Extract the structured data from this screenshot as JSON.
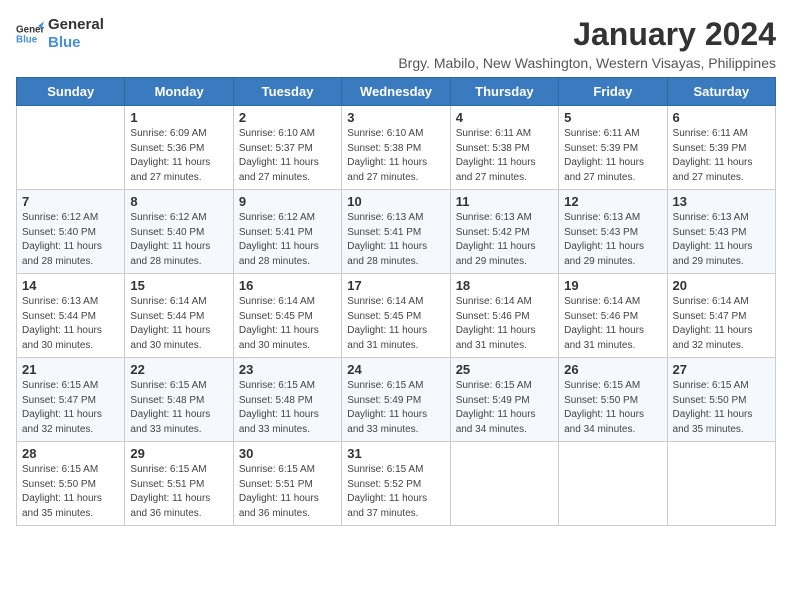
{
  "logo": {
    "line1": "General",
    "line2": "Blue"
  },
  "title": "January 2024",
  "subtitle": "Brgy. Mabilo, New Washington, Western Visayas, Philippines",
  "days_of_week": [
    "Sunday",
    "Monday",
    "Tuesday",
    "Wednesday",
    "Thursday",
    "Friday",
    "Saturday"
  ],
  "weeks": [
    [
      {
        "day": "",
        "info": ""
      },
      {
        "day": "1",
        "info": "Sunrise: 6:09 AM\nSunset: 5:36 PM\nDaylight: 11 hours\nand 27 minutes."
      },
      {
        "day": "2",
        "info": "Sunrise: 6:10 AM\nSunset: 5:37 PM\nDaylight: 11 hours\nand 27 minutes."
      },
      {
        "day": "3",
        "info": "Sunrise: 6:10 AM\nSunset: 5:38 PM\nDaylight: 11 hours\nand 27 minutes."
      },
      {
        "day": "4",
        "info": "Sunrise: 6:11 AM\nSunset: 5:38 PM\nDaylight: 11 hours\nand 27 minutes."
      },
      {
        "day": "5",
        "info": "Sunrise: 6:11 AM\nSunset: 5:39 PM\nDaylight: 11 hours\nand 27 minutes."
      },
      {
        "day": "6",
        "info": "Sunrise: 6:11 AM\nSunset: 5:39 PM\nDaylight: 11 hours\nand 27 minutes."
      }
    ],
    [
      {
        "day": "7",
        "info": "Sunrise: 6:12 AM\nSunset: 5:40 PM\nDaylight: 11 hours\nand 28 minutes."
      },
      {
        "day": "8",
        "info": "Sunrise: 6:12 AM\nSunset: 5:40 PM\nDaylight: 11 hours\nand 28 minutes."
      },
      {
        "day": "9",
        "info": "Sunrise: 6:12 AM\nSunset: 5:41 PM\nDaylight: 11 hours\nand 28 minutes."
      },
      {
        "day": "10",
        "info": "Sunrise: 6:13 AM\nSunset: 5:41 PM\nDaylight: 11 hours\nand 28 minutes."
      },
      {
        "day": "11",
        "info": "Sunrise: 6:13 AM\nSunset: 5:42 PM\nDaylight: 11 hours\nand 29 minutes."
      },
      {
        "day": "12",
        "info": "Sunrise: 6:13 AM\nSunset: 5:43 PM\nDaylight: 11 hours\nand 29 minutes."
      },
      {
        "day": "13",
        "info": "Sunrise: 6:13 AM\nSunset: 5:43 PM\nDaylight: 11 hours\nand 29 minutes."
      }
    ],
    [
      {
        "day": "14",
        "info": "Sunrise: 6:13 AM\nSunset: 5:44 PM\nDaylight: 11 hours\nand 30 minutes."
      },
      {
        "day": "15",
        "info": "Sunrise: 6:14 AM\nSunset: 5:44 PM\nDaylight: 11 hours\nand 30 minutes."
      },
      {
        "day": "16",
        "info": "Sunrise: 6:14 AM\nSunset: 5:45 PM\nDaylight: 11 hours\nand 30 minutes."
      },
      {
        "day": "17",
        "info": "Sunrise: 6:14 AM\nSunset: 5:45 PM\nDaylight: 11 hours\nand 31 minutes."
      },
      {
        "day": "18",
        "info": "Sunrise: 6:14 AM\nSunset: 5:46 PM\nDaylight: 11 hours\nand 31 minutes."
      },
      {
        "day": "19",
        "info": "Sunrise: 6:14 AM\nSunset: 5:46 PM\nDaylight: 11 hours\nand 31 minutes."
      },
      {
        "day": "20",
        "info": "Sunrise: 6:14 AM\nSunset: 5:47 PM\nDaylight: 11 hours\nand 32 minutes."
      }
    ],
    [
      {
        "day": "21",
        "info": "Sunrise: 6:15 AM\nSunset: 5:47 PM\nDaylight: 11 hours\nand 32 minutes."
      },
      {
        "day": "22",
        "info": "Sunrise: 6:15 AM\nSunset: 5:48 PM\nDaylight: 11 hours\nand 33 minutes."
      },
      {
        "day": "23",
        "info": "Sunrise: 6:15 AM\nSunset: 5:48 PM\nDaylight: 11 hours\nand 33 minutes."
      },
      {
        "day": "24",
        "info": "Sunrise: 6:15 AM\nSunset: 5:49 PM\nDaylight: 11 hours\nand 33 minutes."
      },
      {
        "day": "25",
        "info": "Sunrise: 6:15 AM\nSunset: 5:49 PM\nDaylight: 11 hours\nand 34 minutes."
      },
      {
        "day": "26",
        "info": "Sunrise: 6:15 AM\nSunset: 5:50 PM\nDaylight: 11 hours\nand 34 minutes."
      },
      {
        "day": "27",
        "info": "Sunrise: 6:15 AM\nSunset: 5:50 PM\nDaylight: 11 hours\nand 35 minutes."
      }
    ],
    [
      {
        "day": "28",
        "info": "Sunrise: 6:15 AM\nSunset: 5:50 PM\nDaylight: 11 hours\nand 35 minutes."
      },
      {
        "day": "29",
        "info": "Sunrise: 6:15 AM\nSunset: 5:51 PM\nDaylight: 11 hours\nand 36 minutes."
      },
      {
        "day": "30",
        "info": "Sunrise: 6:15 AM\nSunset: 5:51 PM\nDaylight: 11 hours\nand 36 minutes."
      },
      {
        "day": "31",
        "info": "Sunrise: 6:15 AM\nSunset: 5:52 PM\nDaylight: 11 hours\nand 37 minutes."
      },
      {
        "day": "",
        "info": ""
      },
      {
        "day": "",
        "info": ""
      },
      {
        "day": "",
        "info": ""
      }
    ]
  ]
}
